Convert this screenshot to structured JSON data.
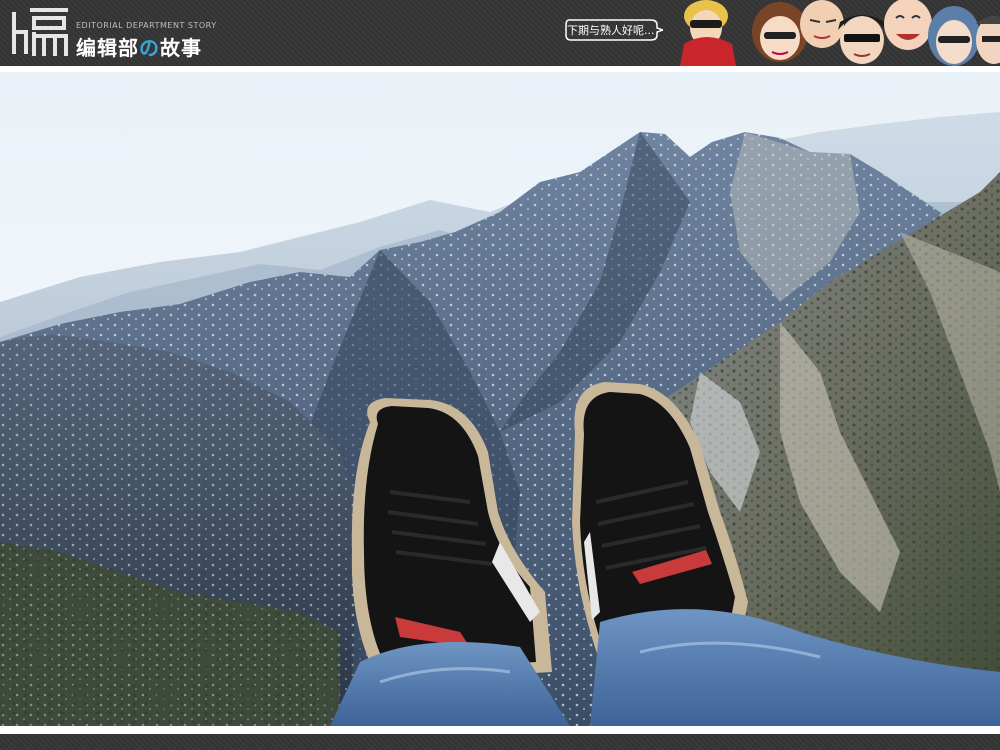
{
  "header": {
    "logo_alt": "编",
    "tagline": "EDITORIAL DEPARTMENT STORY",
    "title_part1": "编辑部",
    "title_accent": "の",
    "title_part2": "故事",
    "speech_bubble": "下期与熟人好呢..."
  },
  "photo": {
    "subject": "feet-dangling-over-mountains"
  },
  "colors": {
    "header_bg": "#363636",
    "accent_blue": "#39a6d8",
    "sky": "#eaf2f8",
    "mountain_dark": "#3f5066",
    "snow": "#d9e2ea"
  }
}
